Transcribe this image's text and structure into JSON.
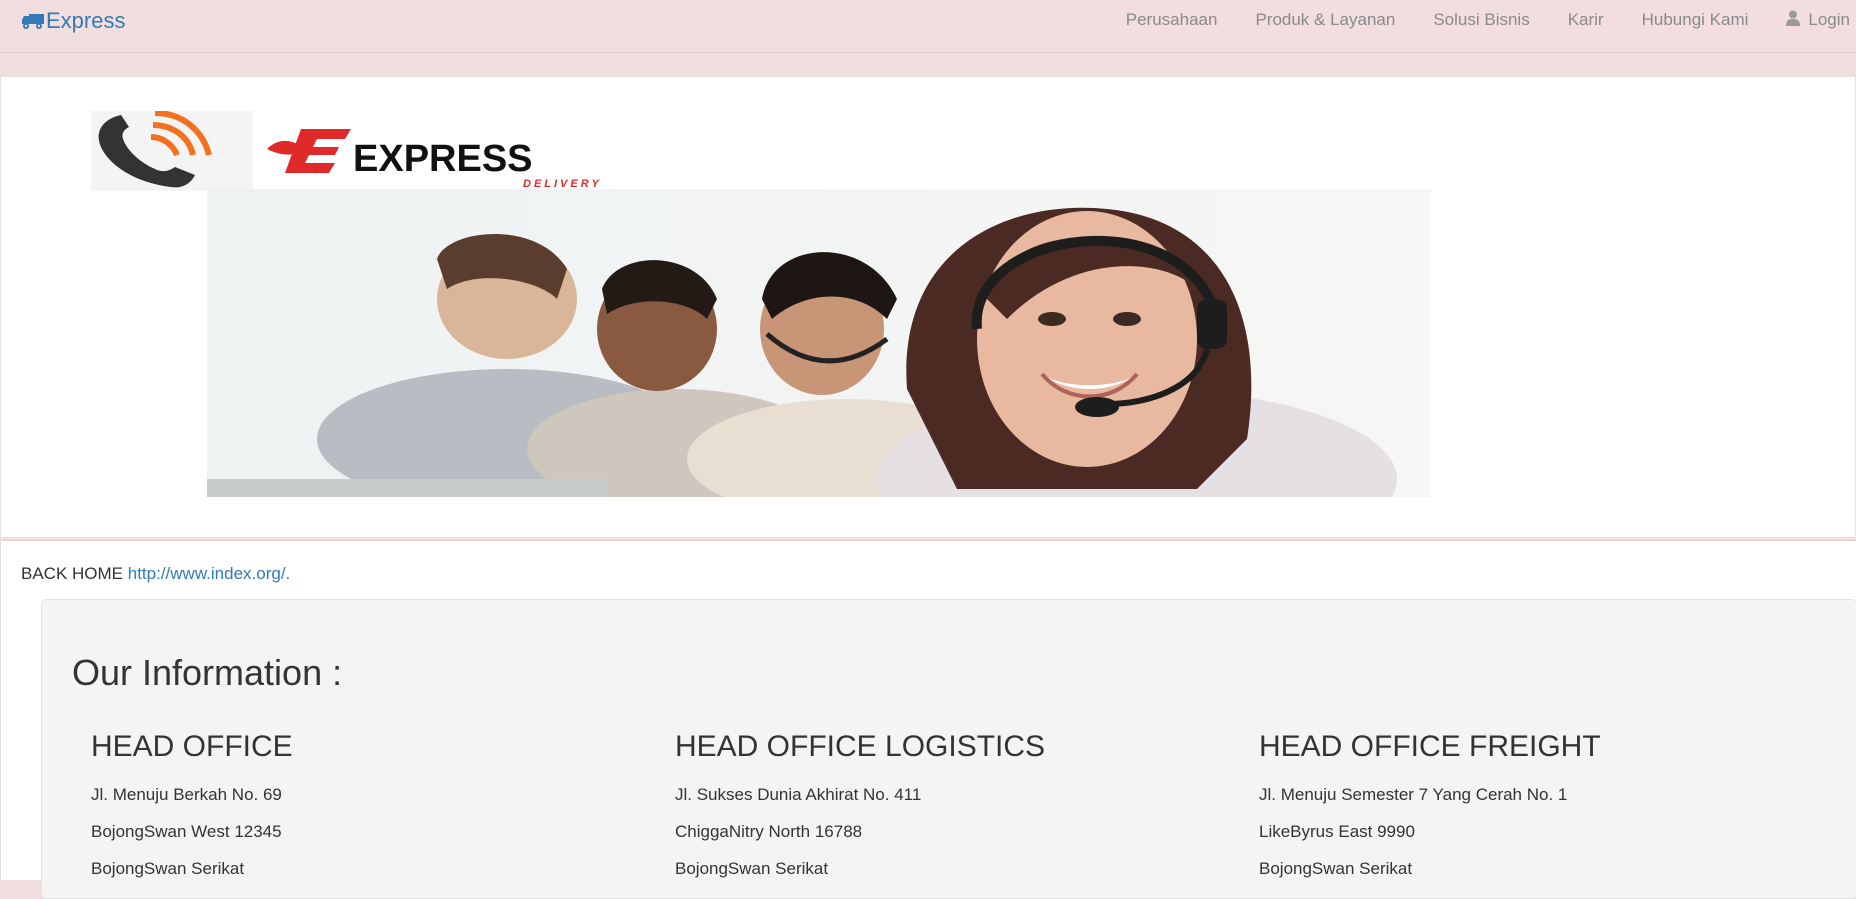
{
  "navbar": {
    "brand_label": "Express",
    "brand_icon": "truck-icon",
    "links": [
      "Perusahaan",
      "Produk & Layanan",
      "Solusi Bisnis",
      "Karir",
      "Hubungi Kami"
    ],
    "login_label": "Login",
    "login_icon": "user-icon",
    "accent_color": "#337ab7",
    "background_color": "#f2dede"
  },
  "hero": {
    "logo_text": "EXPRESS",
    "logo_subtext": "DELIVERY",
    "logo_color": "#e02a2a",
    "photo": "customer-service-agents-with-headsets"
  },
  "back_home": {
    "prefix": "BACK HOME ",
    "link_text": "http://www.index.org/.",
    "suffix": ""
  },
  "info": {
    "title": "Our Information :",
    "offices": [
      {
        "name": "HEAD OFFICE",
        "lines": [
          "Jl. Menuju Berkah No. 69",
          "BojongSwan West 12345",
          "BojongSwan Serikat"
        ]
      },
      {
        "name": "HEAD OFFICE LOGISTICS",
        "lines": [
          "Jl. Sukses Dunia Akhirat No. 411",
          "ChiggaNitry North 16788",
          "BojongSwan Serikat"
        ]
      },
      {
        "name": "HEAD OFFICE FREIGHT",
        "lines": [
          "Jl. Menuju Semester 7 Yang Cerah No. 1",
          "LikeByrus East 9990",
          "BojongSwan Serikat"
        ]
      }
    ]
  }
}
